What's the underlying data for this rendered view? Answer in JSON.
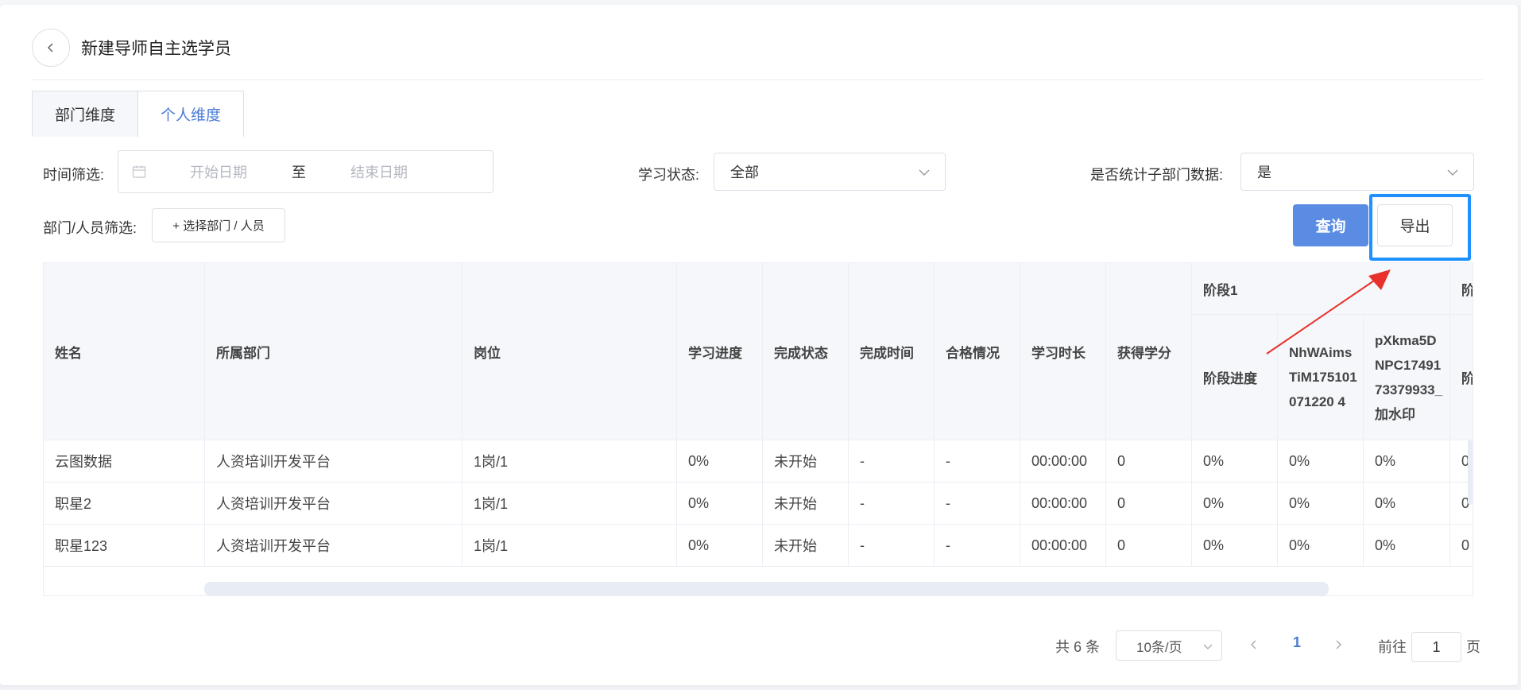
{
  "page": {
    "title": "新建导师自主选学员"
  },
  "tabs": [
    {
      "label": "部门维度",
      "active": false
    },
    {
      "label": "个人维度",
      "active": true
    }
  ],
  "filters": {
    "time_label": "时间筛选:",
    "start_placeholder": "开始日期",
    "range_sep": "至",
    "end_placeholder": "结束日期",
    "status_label": "学习状态:",
    "status_value": "全部",
    "subdept_label": "是否统计子部门数据:",
    "subdept_value": "是",
    "dept_label": "部门/人员筛选:",
    "dept_button": "+ 选择部门 / 人员"
  },
  "actions": {
    "query": "查询",
    "export": "导出"
  },
  "table": {
    "group_stage1": "阶段1",
    "group_stage2_partial": "阶",
    "columns": {
      "name": "姓名",
      "dept": "所属部门",
      "post": "岗位",
      "progress": "学习进度",
      "status": "完成状态",
      "done_time": "完成时间",
      "pass": "合格情况",
      "duration": "学习时长",
      "credit": "获得学分",
      "stage_progress": "阶段进度",
      "c1": "NhWAimsTiM175101071220 4",
      "c2": "pXkma5DNPC1749173379933_加水印",
      "next_partial": "阶"
    },
    "rows": [
      {
        "name": "云图数据",
        "dept": "人资培训开发平台",
        "post": "1岗/1",
        "progress": "0%",
        "status": "未开始",
        "done_time": "-",
        "pass": "-",
        "duration": "00:00:00",
        "credit": "0",
        "stage_progress": "0%",
        "c1": "0%",
        "c2": "0%",
        "next": "0"
      },
      {
        "name": "职星2",
        "dept": "人资培训开发平台",
        "post": "1岗/1",
        "progress": "0%",
        "status": "未开始",
        "done_time": "-",
        "pass": "-",
        "duration": "00:00:00",
        "credit": "0",
        "stage_progress": "0%",
        "c1": "0%",
        "c2": "0%",
        "next": "0"
      },
      {
        "name": "职星123",
        "dept": "人资培训开发平台",
        "post": "1岗/1",
        "progress": "0%",
        "status": "未开始",
        "done_time": "-",
        "pass": "-",
        "duration": "00:00:00",
        "credit": "0",
        "stage_progress": "0%",
        "c1": "0%",
        "c2": "0%",
        "next": "0"
      }
    ]
  },
  "pagination": {
    "total": "共 6 条",
    "page_size": "10条/页",
    "current": "1",
    "goto_label": "前往",
    "goto_value": "1",
    "page_suffix": "页"
  },
  "colors": {
    "accent": "#4a7bd6",
    "primary_button": "#5b8ce3",
    "highlight": "#1e90ff",
    "arrow": "#e8312a"
  }
}
